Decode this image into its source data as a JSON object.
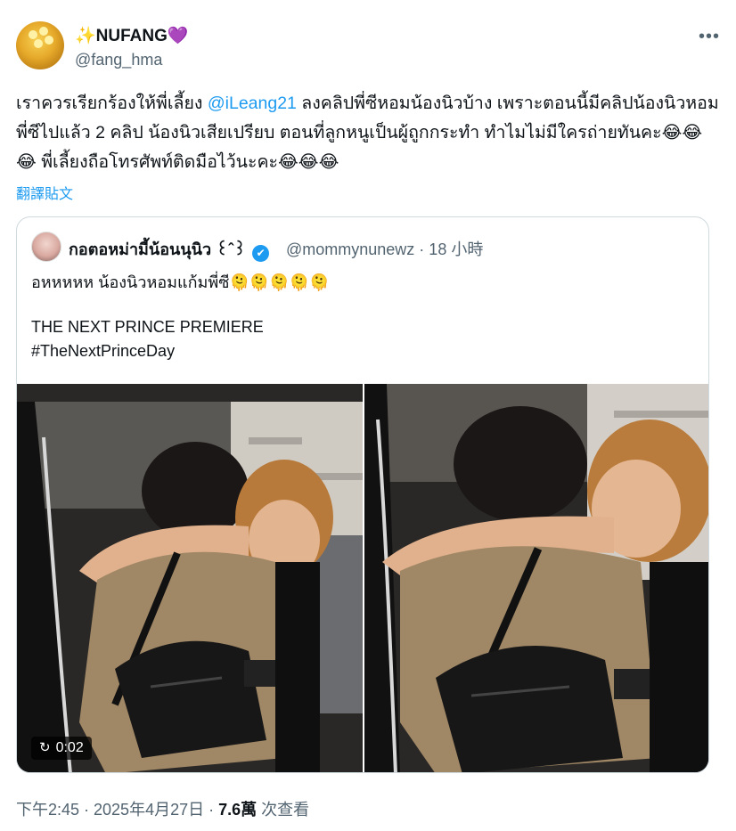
{
  "user": {
    "display_name_prefix": "✨",
    "display_name": "NUFANG",
    "display_name_suffix": "💜",
    "handle": "@fang_hma",
    "more_label": "•••"
  },
  "tweet": {
    "text_part1": "เราควรเรียกร้องให้พี่เลี้ยง ",
    "mention": "@iLeang21",
    "text_part2": " ลงคลิปพี่ซีหอมน้องนิวบ้าง เพราะตอนนี้มีคลิปน้องนิวหอมพี่ซีไปแล้ว 2 คลิป น้องนิวเสียเปรียบ ตอนที่ลูกหนูเป็นผู้ถูกกระทำ ทำไมไม่มีใครถ่ายทันคะ😂😂😂 พี่เลี้ยงถือโทรศัพท์ติดมือไว้นะคะ😂😂😂",
    "translate_label": "翻譯貼文"
  },
  "quoted": {
    "display_name": "กอตอหม่ามี้น้อนนุนิว ꒰ˆ꒱",
    "verified_glyph": "✔",
    "handle_time": "@mommynunewz · 18 小時",
    "line1": "อหหหหห น้องนิวหอมแก้มพี่ซี🫠🫠🫠🫠🫠",
    "line2": "THE NEXT PRINCE PREMIERE",
    "line3": "#TheNextPrinceDay",
    "video_badge": {
      "icon": "↻",
      "duration": "0:02"
    }
  },
  "footer": {
    "timestamp": "下午2:45 · 2025年4月27日 · ",
    "views_count": "7.6萬",
    "views_label": " 次查看"
  },
  "colors": {
    "accent": "#1d9bf0",
    "secondary_text": "#536471",
    "border": "#cfd9de"
  }
}
